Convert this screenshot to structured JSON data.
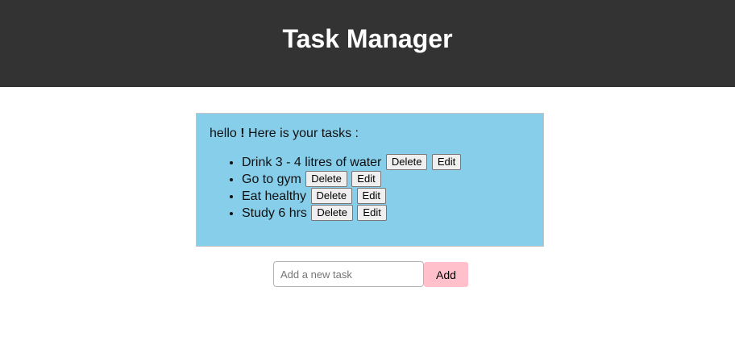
{
  "header": {
    "title": "Task Manager"
  },
  "tasks_panel": {
    "greeting_prefix": "hello ",
    "greeting_mark": "!",
    "greeting_suffix": " Here is your tasks :",
    "delete_label": "Delete",
    "edit_label": "Edit",
    "items": [
      {
        "text": "Drink 3 - 4 litres of water"
      },
      {
        "text": "Go to gym"
      },
      {
        "text": "Eat healthy"
      },
      {
        "text": "Study 6 hrs"
      }
    ]
  },
  "add_task": {
    "placeholder": "Add a new task",
    "value": "",
    "button_label": "Add"
  },
  "colors": {
    "header_bg": "#333333",
    "panel_bg": "#87ceeb",
    "add_button_bg": "#ffc0cb"
  }
}
